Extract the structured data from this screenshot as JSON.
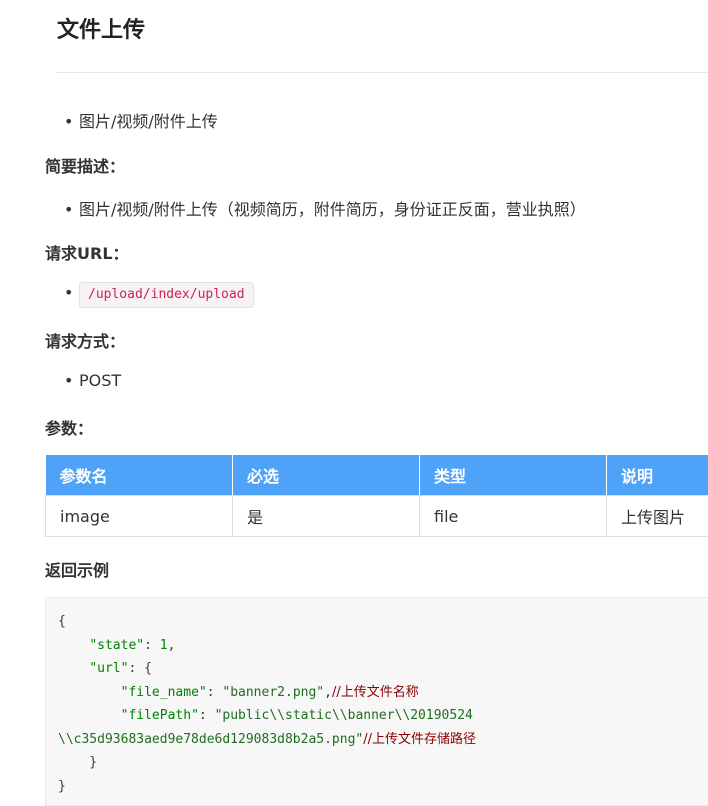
{
  "page": {
    "title": "文件上传"
  },
  "intro": {
    "bullet": "图片/视频/附件上传"
  },
  "summary": {
    "label": "简要描述：",
    "text": "图片/视频/附件上传（视频简历，附件简历，身份证正反面，营业执照）"
  },
  "request_url": {
    "label": "请求URL：",
    "url": "/upload/index/upload"
  },
  "request_method": {
    "label": "请求方式：",
    "method": "POST"
  },
  "params": {
    "label": "参数：",
    "headers": [
      "参数名",
      "必选",
      "类型",
      "说明"
    ],
    "rows": [
      [
        "image",
        "是",
        "file",
        "上传图片"
      ]
    ]
  },
  "example": {
    "label": "返回示例",
    "lines": [
      {
        "text": "{"
      },
      {
        "indent": "    ",
        "key": "\"state\"",
        "sep": ": ",
        "value": "1",
        "vclass": "num",
        "tail": ","
      },
      {
        "indent": "    ",
        "key": "\"url\"",
        "sep": ": ",
        "value": "{",
        "vclass": "",
        "tail": ""
      },
      {
        "indent": "        ",
        "key": "\"file_name\"",
        "sep": ": ",
        "value": "\"banner2.png\"",
        "vclass": "str",
        "tail": ",",
        "comment": "//上传文件名称"
      },
      {
        "indent": "        ",
        "key": "\"filePath\"",
        "sep": ": ",
        "value": "\"public\\\\static\\\\banner\\\\20190524",
        "vclass": "str",
        "tail": ""
      },
      {
        "indent": "",
        "key": "",
        "sep": "",
        "value": "\\\\c35d93683aed9e78de6d129083d8b2a5.png\"",
        "vclass": "str",
        "tail": "",
        "comment": "//上传文件存储路径"
      },
      {
        "text": "    }"
      },
      {
        "text": "}"
      }
    ]
  },
  "colors": {
    "table_header_bg": "#4ea2f8",
    "inline_code": "#c7254e"
  }
}
